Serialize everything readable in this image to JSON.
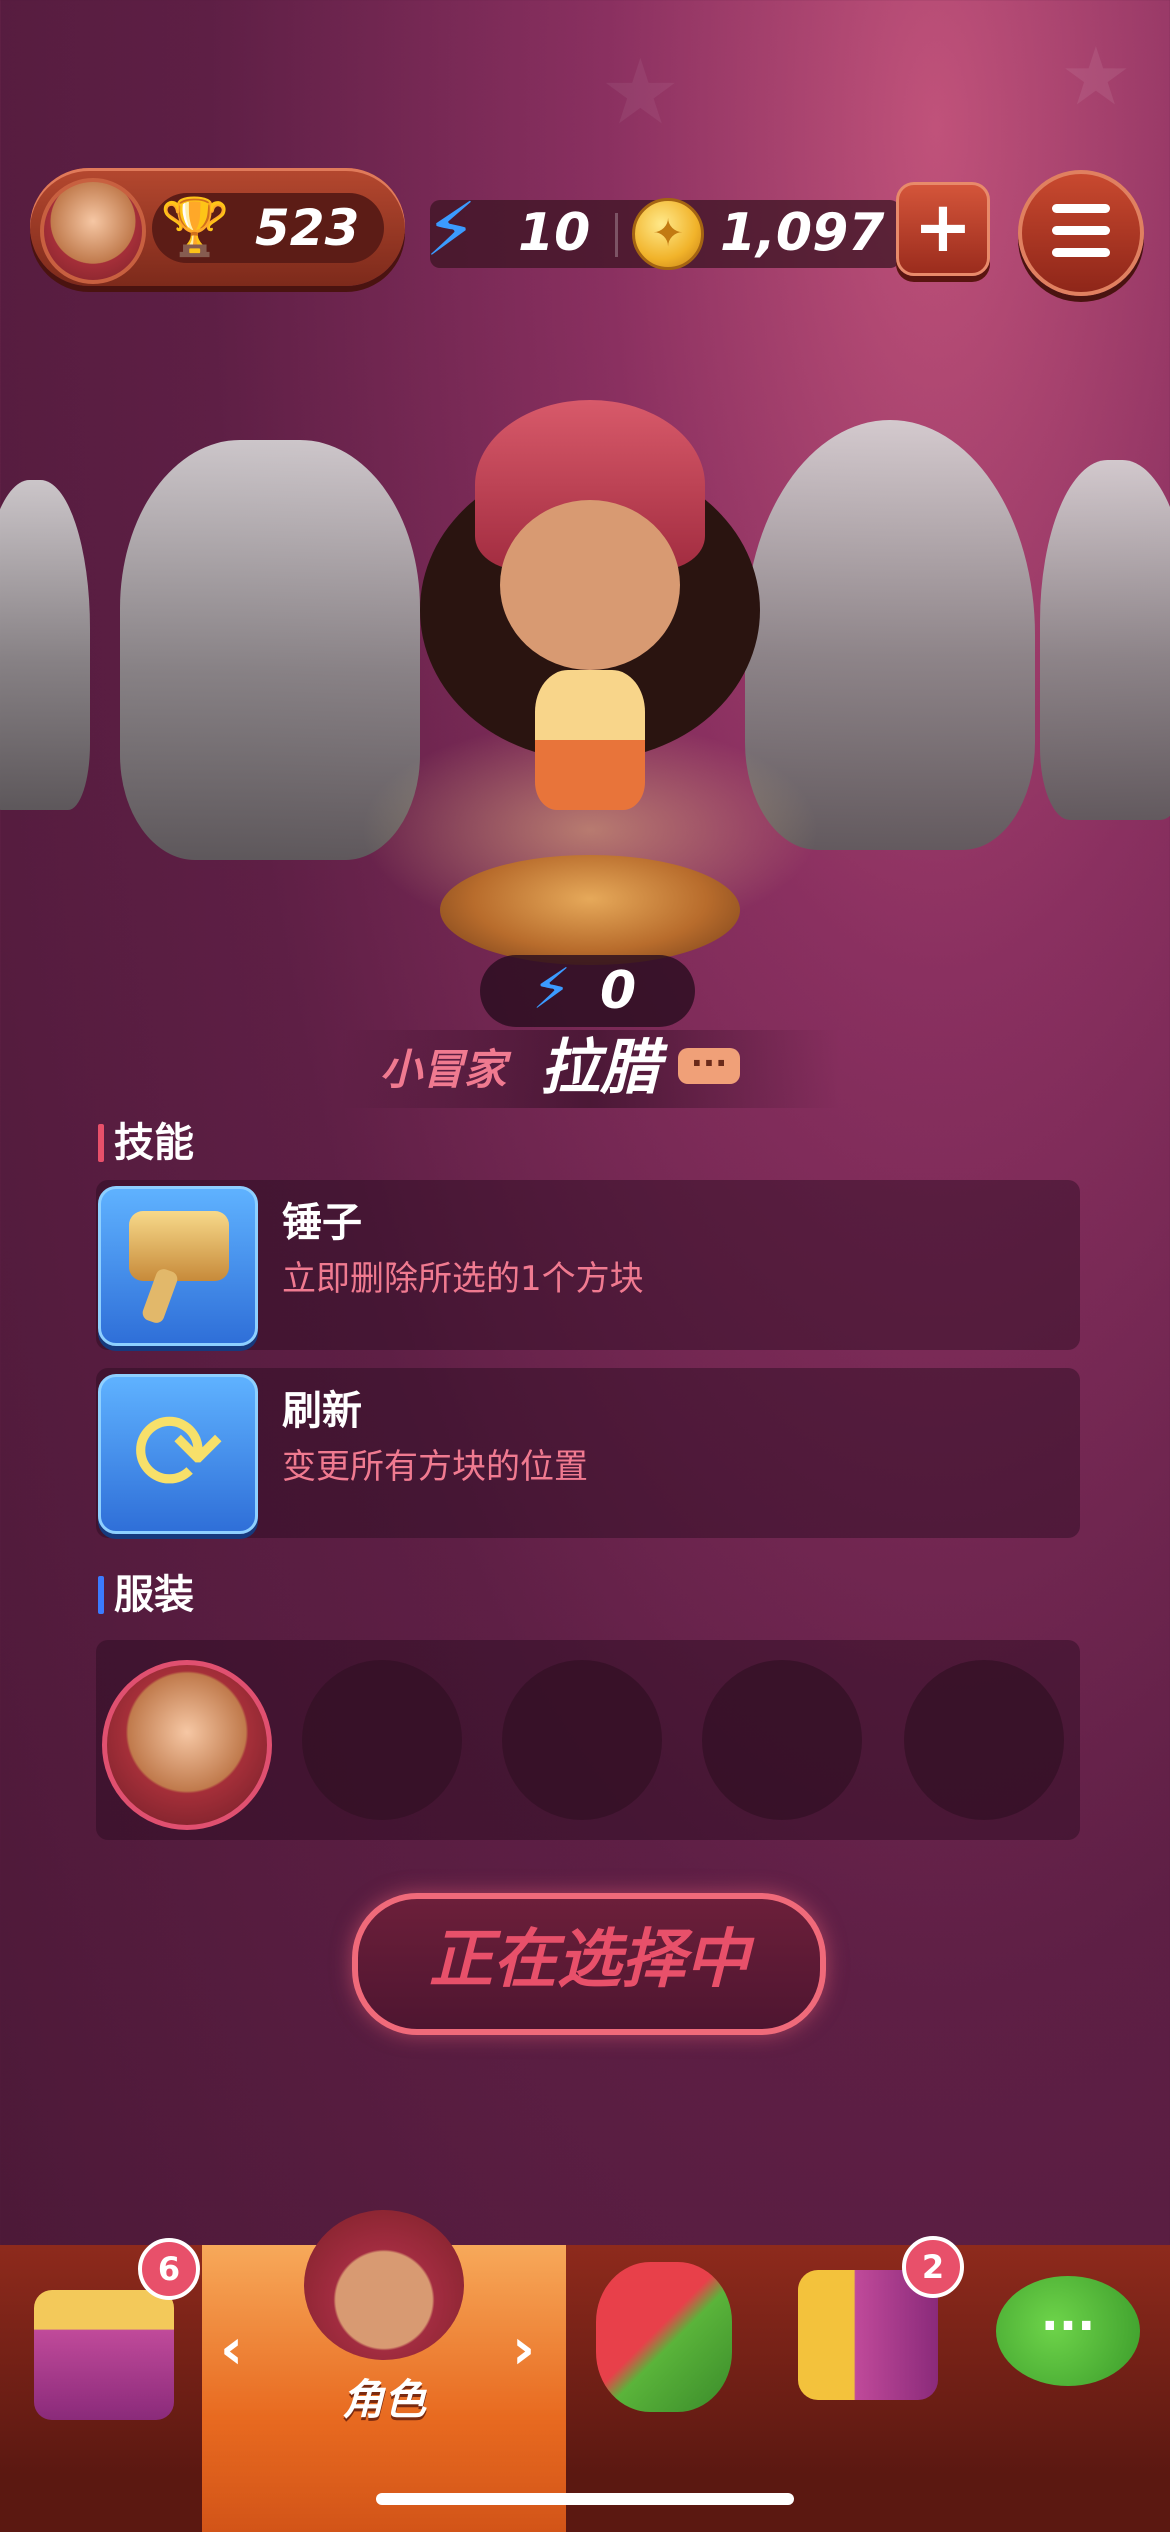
{
  "hud": {
    "trophies": "523",
    "energy": "10",
    "coins": "1,097",
    "plus_label": "+"
  },
  "character": {
    "energy_cost": "0",
    "title": "小冒家",
    "name": "拉腊"
  },
  "skills": {
    "section_title": "技能",
    "items": [
      {
        "name": "锤子",
        "desc": "立即删除所选的1个方块"
      },
      {
        "name": "刷新",
        "desc": "变更所有方块的位置"
      }
    ]
  },
  "outfits": {
    "section_title": "服装"
  },
  "action": {
    "select_label": "正在选择中"
  },
  "nav": {
    "chest_badge": "6",
    "active_label": "角色",
    "quest_badge": "2"
  },
  "colors": {
    "accent": "#e8506a",
    "skill_desc": "#f07a90",
    "energy_blue": "#3b9bff",
    "skills_bar": "#e8506a",
    "outfits_bar": "#3b7bff"
  }
}
